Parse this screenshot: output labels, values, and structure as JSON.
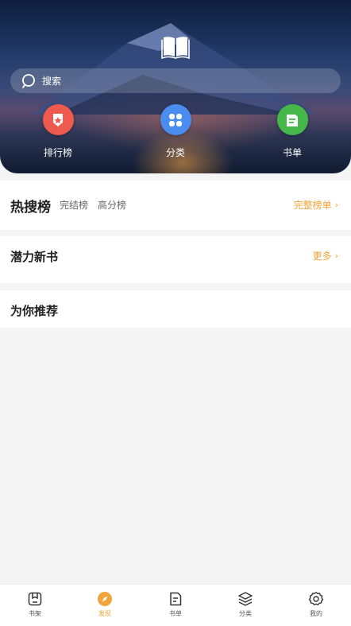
{
  "search": {
    "placeholder": "搜索"
  },
  "categories": [
    {
      "label": "排行榜",
      "icon": "ranking-badge-icon",
      "color": "#ef5a4f"
    },
    {
      "label": "分类",
      "icon": "category-grid-icon",
      "color": "#4a8cf0"
    },
    {
      "label": "书单",
      "icon": "booklist-icon",
      "color": "#46b84a"
    }
  ],
  "hot": {
    "title": "热搜榜",
    "tabs": [
      "完结榜",
      "高分榜"
    ],
    "more": "完整榜单"
  },
  "new_books": {
    "title": "潜力新书",
    "more": "更多"
  },
  "recommend": {
    "title": "为你推荐"
  },
  "nav": [
    {
      "label": "书架",
      "icon": "bookshelf-icon"
    },
    {
      "label": "发现",
      "icon": "compass-icon",
      "active": true
    },
    {
      "label": "书单",
      "icon": "booklist-icon"
    },
    {
      "label": "分类",
      "icon": "layers-icon"
    },
    {
      "label": "我的",
      "icon": "settings-gear-icon"
    }
  ],
  "colors": {
    "accent": "#f0a43a"
  }
}
